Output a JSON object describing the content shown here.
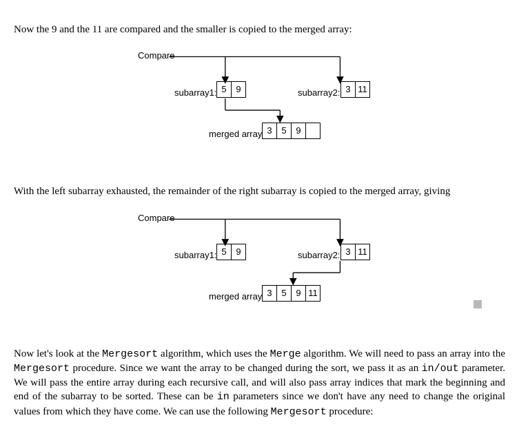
{
  "para1_a": "Now the 9 and the 11 are compared and the smaller is copied to the merged array:",
  "diagram1": {
    "compare": "Compare",
    "sub1label": "subarray1:",
    "sub2label": "subarray2:",
    "mergedlabel": "merged array",
    "sub1": [
      "5",
      "9"
    ],
    "sub2": [
      "3",
      "11"
    ],
    "merged": [
      "3",
      "5",
      "9",
      ""
    ]
  },
  "para2_a": "With the left subarray exhausted, the remainder of the right subarray is copied to the merged array, giving",
  "diagram2": {
    "compare": "Compare",
    "sub1label": "subarray1:",
    "sub2label": "subarray2:",
    "mergedlabel": "merged array",
    "sub1": [
      "5",
      "9"
    ],
    "sub2": [
      "3",
      "11"
    ],
    "merged": [
      "3",
      "5",
      "9",
      "11"
    ]
  },
  "para3": {
    "t1": "Now let's look at the ",
    "c1": "Mergesort",
    "t2": " algorithm, which uses the ",
    "c2": "Merge",
    "t3": " algorithm. We will need to pass an array into the ",
    "c3": "Mergesort",
    "t4": " procedure. Since we want the array to be changed during the sort, we pass it as an ",
    "c4": "in/out",
    "t5": " parameter. We will pass the entire array during each recursive call, and will also pass array indices that mark the beginning and end of the subarray to be sorted. These can be ",
    "c5": "in",
    "t6": " parameters since we don't have any need to change the original values from which they have come. We can use the following ",
    "c6": "Mergesort",
    "t7": " procedure:"
  }
}
